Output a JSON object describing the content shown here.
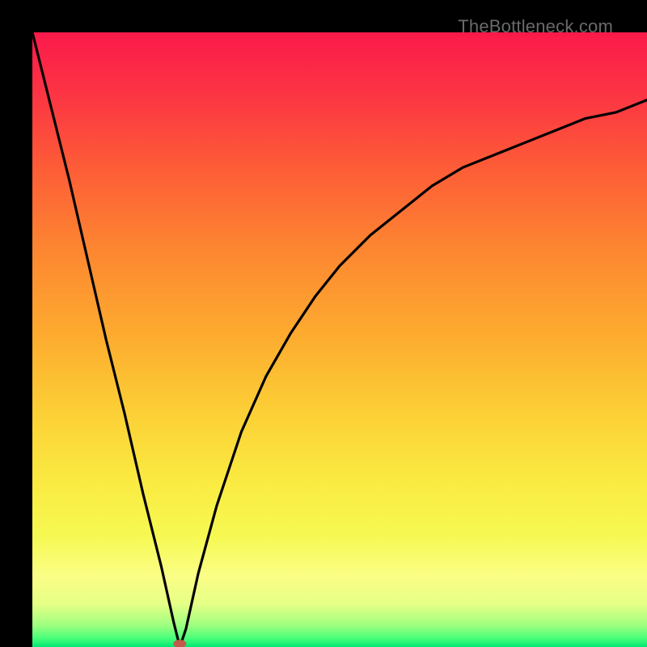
{
  "watermark": "TheBottleneck.com",
  "chart_data": {
    "type": "line",
    "title": "",
    "xlabel": "",
    "ylabel": "",
    "xlim": [
      0,
      100
    ],
    "ylim": [
      0,
      100
    ],
    "grid": false,
    "legend": false,
    "description": "Absolute-value-like curve (bottleneck profile) on a vertical red-to-green gradient background. Minimum (zero) occurs near x ≈ 24. Left branch descends steeply and near-linearly from y=100 at x=0. Right branch rises with decreasing slope (concave), approaching ~89 at x=100.",
    "series": [
      {
        "name": "bottleneck-curve",
        "x": [
          0,
          3,
          6,
          9,
          12,
          15,
          18,
          21,
          23,
          24,
          25,
          27,
          30,
          34,
          38,
          42,
          46,
          50,
          55,
          60,
          65,
          70,
          75,
          80,
          85,
          90,
          95,
          100
        ],
        "values": [
          100,
          88,
          76,
          63,
          50,
          38,
          25,
          13,
          4,
          0,
          3,
          12,
          23,
          35,
          44,
          51,
          57,
          62,
          67,
          71,
          75,
          78,
          80,
          82,
          84,
          86,
          87,
          89
        ]
      }
    ],
    "marker": {
      "x": 24,
      "y": 0,
      "color": "#c15a4a"
    },
    "background_gradient_stops": [
      {
        "offset": 0.0,
        "color": "#fb1a4b"
      },
      {
        "offset": 0.1,
        "color": "#fc3443"
      },
      {
        "offset": 0.22,
        "color": "#fd5c37"
      },
      {
        "offset": 0.35,
        "color": "#fd8531"
      },
      {
        "offset": 0.5,
        "color": "#fdad2f"
      },
      {
        "offset": 0.62,
        "color": "#fcd036"
      },
      {
        "offset": 0.73,
        "color": "#faea41"
      },
      {
        "offset": 0.82,
        "color": "#f6f952"
      },
      {
        "offset": 0.885,
        "color": "#fbfe86"
      },
      {
        "offset": 0.93,
        "color": "#e6ff86"
      },
      {
        "offset": 0.965,
        "color": "#9dff80"
      },
      {
        "offset": 0.985,
        "color": "#4cff7a"
      },
      {
        "offset": 1.0,
        "color": "#00e874"
      }
    ]
  }
}
